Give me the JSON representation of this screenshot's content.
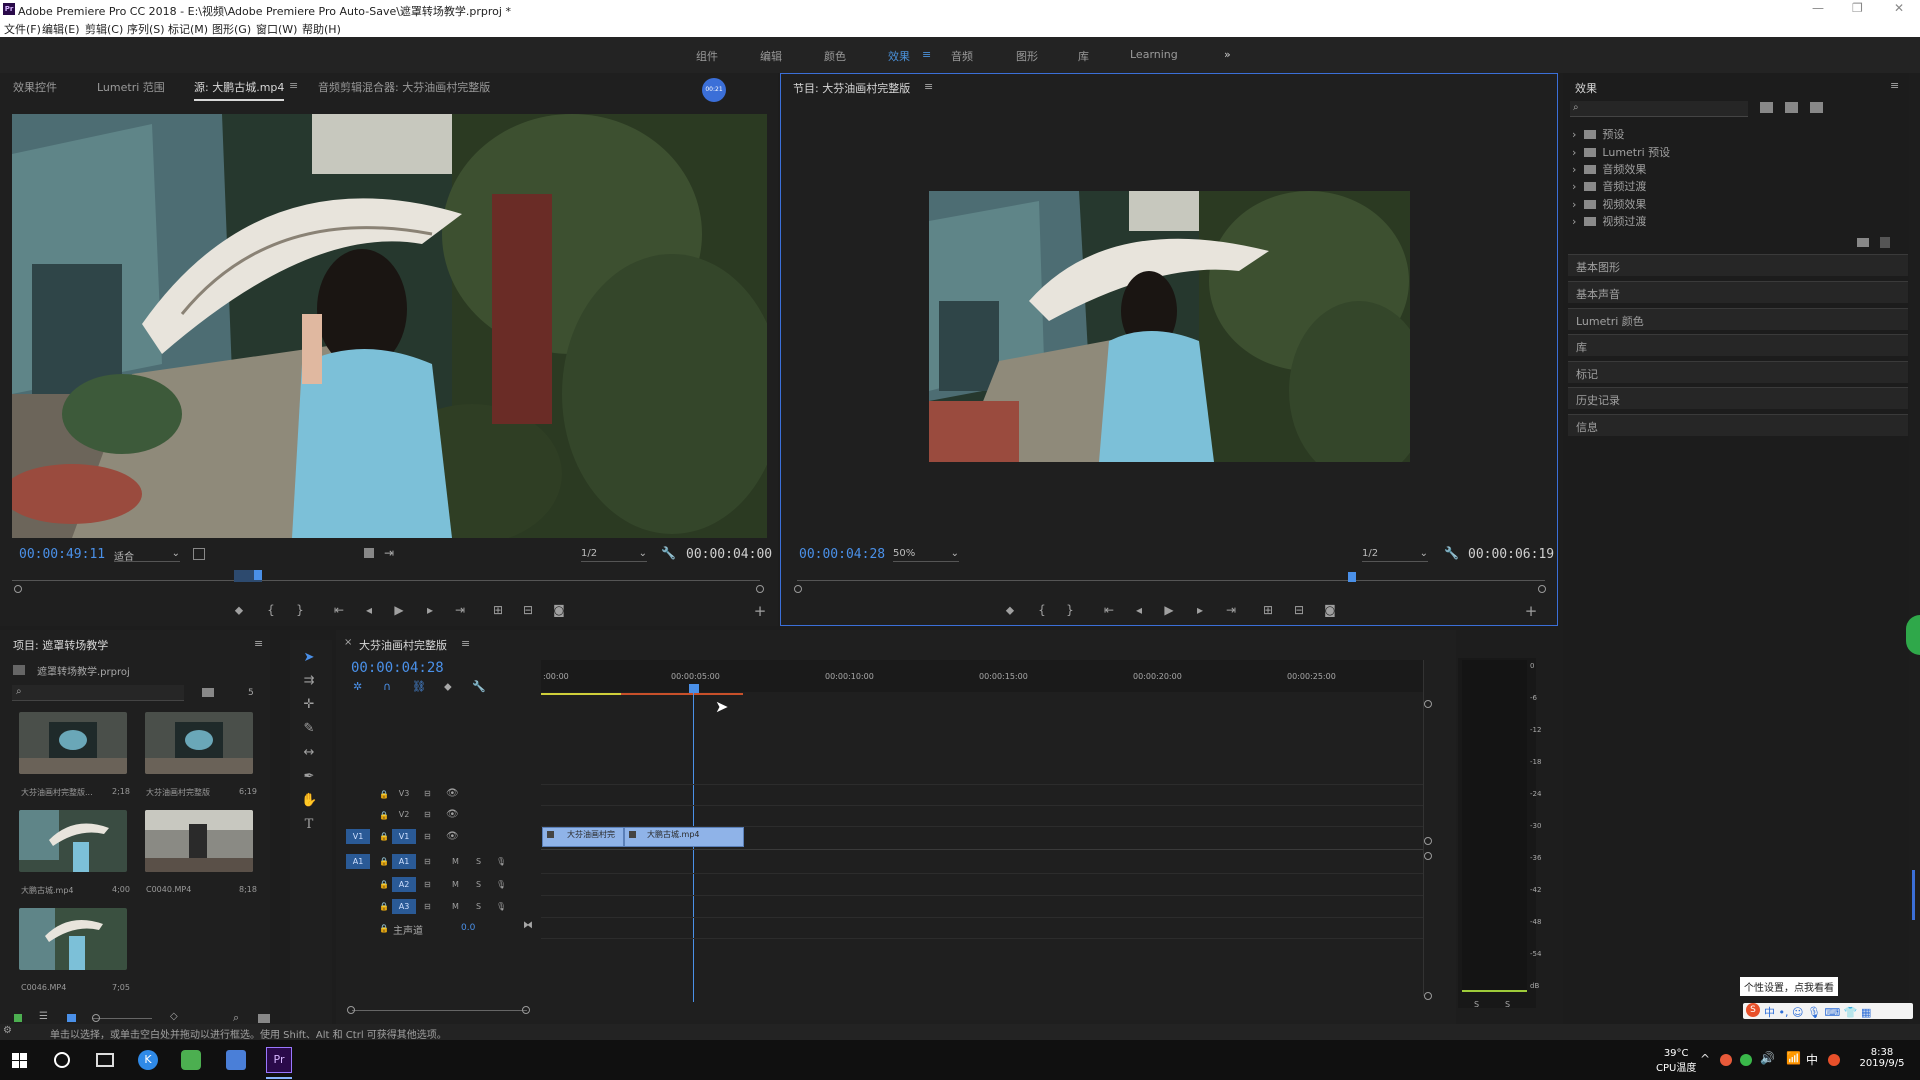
{
  "window": {
    "title": "Adobe Premiere Pro CC 2018 - E:\\视频\\Adobe Premiere Pro Auto-Save\\遮罩转场教学.prproj *",
    "logo": "Pr"
  },
  "menu": [
    "文件(F)",
    "编辑(E)",
    "剪辑(C)",
    "序列(S)",
    "标记(M)",
    "图形(G)",
    "窗口(W)",
    "帮助(H)"
  ],
  "workspaces": [
    "组件",
    "编辑",
    "颜色",
    "效果",
    "音频",
    "图形",
    "库",
    "Learning"
  ],
  "workspace_active": "效果",
  "workspace_more": "»",
  "source_panel": {
    "tabs": [
      "效果控件",
      "Lumetri 范围",
      "源: 大鹏古城.mp4",
      "音频剪辑混合器: 大芬油画村完整版"
    ],
    "tab_menu": "≡",
    "timecode_left": "00:00:49:11",
    "fit": "适合",
    "resolution": "1/2",
    "timecode_right": "00:00:04:00",
    "badge": "00:21"
  },
  "program_panel": {
    "title": "节目: 大芬油画村完整版",
    "tab_menu": "≡",
    "timecode_left": "00:00:04:28",
    "zoom": "50%",
    "resolution": "1/2",
    "timecode_right": "00:00:06:19"
  },
  "effects_panel": {
    "title": "效果",
    "tree": [
      "预设",
      "Lumetri 预设",
      "音频效果",
      "音频过渡",
      "视频效果",
      "视频过渡"
    ],
    "sections": [
      "基本图形",
      "基本声音",
      "Lumetri 颜色",
      "库",
      "标记",
      "历史记录",
      "信息"
    ]
  },
  "project_panel": {
    "title": "项目: 遮罩转场教学",
    "file": "遮罩转场教学.prproj",
    "count": "5",
    "items": [
      {
        "name": "大芬油画村完整版...",
        "dur": "2;18"
      },
      {
        "name": "大芬油画村完整版",
        "dur": "6;19"
      },
      {
        "name": "大鹏古城.mp4",
        "dur": "4;00"
      },
      {
        "name": "C0040.MP4",
        "dur": "8;18"
      },
      {
        "name": "C0046.MP4",
        "dur": "7;05"
      }
    ]
  },
  "timeline": {
    "title": "大芬油画村完整版",
    "timecode": "00:00:04:28",
    "ruler": [
      ":00:00",
      "00:00:05:00",
      "00:00:10:00",
      "00:00:15:00",
      "00:00:20:00",
      "00:00:25:00"
    ],
    "video_tracks": [
      "V3",
      "V2",
      "V1"
    ],
    "audio_tracks": [
      "A1",
      "A2",
      "A3"
    ],
    "master_label": "主声道",
    "master_value": "0.0",
    "clips": [
      {
        "name": "大芬油画村完",
        "track": "V1"
      },
      {
        "name": "大鹏古城.mp4",
        "track": "V1"
      }
    ],
    "mute_label": "M",
    "solo_label": "S"
  },
  "audio_meter": {
    "scale": [
      "0",
      "-6",
      "-12",
      "-18",
      "-24",
      "-30",
      "-36",
      "-42",
      "-48",
      "-54",
      "dB"
    ],
    "channels": [
      "S",
      "S"
    ]
  },
  "tools": [
    "selection",
    "track-select",
    "ripple",
    "razor",
    "slip",
    "pen",
    "hand",
    "type"
  ],
  "status": "单击以选择，或单击空白处并拖动以进行框选。使用 Shift、Alt 和 Ctrl 可获得其他选项。",
  "tooltip": "个性设置，点我看看",
  "taskbar": {
    "temp": "39°C",
    "cpu": "CPU温度",
    "ime": "中",
    "time": "8:38",
    "date": "2019/9/5"
  }
}
